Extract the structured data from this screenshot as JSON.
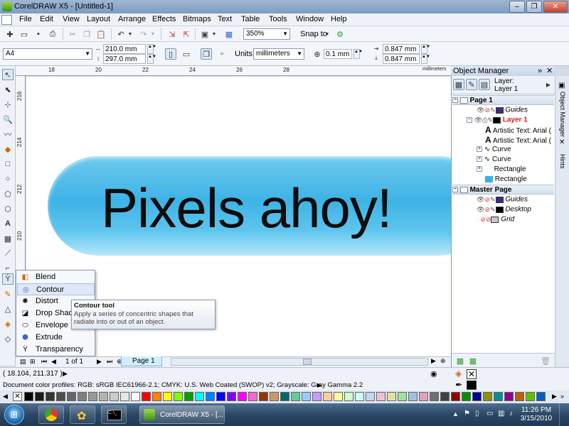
{
  "window": {
    "title": "CorelDRAW X5 - [Untitled-1]",
    "minimize": "–",
    "restore": "❐",
    "close": "✕"
  },
  "menu": [
    "File",
    "Edit",
    "View",
    "Layout",
    "Arrange",
    "Effects",
    "Bitmaps",
    "Text",
    "Table",
    "Tools",
    "Window",
    "Help"
  ],
  "std_toolbar": {
    "zoom": "350%",
    "snap_label": "Snap to"
  },
  "property_bar": {
    "paper": "A4",
    "width": "210.0 mm",
    "height": "297.0 mm",
    "units_label": "Units:",
    "units": "millimeters",
    "nudge": "0.1 mm",
    "dup_x": "0.847 mm",
    "dup_y": "0.847 mm"
  },
  "ruler_top": {
    "ticks": [
      "18",
      "20",
      "22",
      "24",
      "26",
      "28"
    ],
    "units": "millimeters"
  },
  "ruler_left": {
    "ticks": [
      "216",
      "214",
      "212",
      "210"
    ]
  },
  "canvas": {
    "artistic_text": "Pixels ahoy!"
  },
  "flyout": {
    "items": [
      {
        "label": "Blend",
        "icon": "blend-icon"
      },
      {
        "label": "Contour",
        "icon": "contour-icon"
      },
      {
        "label": "Distort",
        "icon": "distort-icon"
      },
      {
        "label": "Drop Shadow",
        "icon": "drop-shadow-icon"
      },
      {
        "label": "Envelope",
        "icon": "envelope-icon"
      },
      {
        "label": "Extrude",
        "icon": "extrude-icon"
      },
      {
        "label": "Transparency",
        "icon": "transparency-icon"
      }
    ],
    "selected": "Contour"
  },
  "tooltip": {
    "title": "Contour tool",
    "body": "Apply a series of concentric shapes that radiate into or out of an object."
  },
  "page_nav": {
    "counter": "1 of 1",
    "page_tab": "Page 1"
  },
  "object_manager": {
    "title": "Object Manager",
    "layer_label": "Layer:",
    "layer_name": "Layer 1",
    "tree": [
      {
        "label": "Page 1",
        "kind": "header"
      },
      {
        "label": "Guides",
        "kind": "layer",
        "color": "#3d2a8a"
      },
      {
        "label": "Layer 1",
        "kind": "layer-active",
        "color": "#000000"
      },
      {
        "label": "Artistic Text: Arial (",
        "kind": "object"
      },
      {
        "label": "Artistic Text: Arial (",
        "kind": "object"
      },
      {
        "label": "Curve",
        "kind": "object"
      },
      {
        "label": "Curve",
        "kind": "object"
      },
      {
        "label": "Rectangle",
        "kind": "object"
      },
      {
        "label": "Rectangle",
        "kind": "object",
        "color": "#3ab0e2"
      },
      {
        "label": "Master Page",
        "kind": "header"
      },
      {
        "label": "Guides",
        "kind": "layer",
        "color": "#3d2a8a"
      },
      {
        "label": "Desktop",
        "kind": "layer",
        "color": "#000000"
      },
      {
        "label": "Grid",
        "kind": "layer",
        "color": "#c8c8c8"
      }
    ],
    "side_tabs": [
      "Object Manager",
      "Hints"
    ]
  },
  "status": {
    "coords": "( 18.104, 211.317 )",
    "profiles": "Document color profiles: RGB: sRGB IEC61966-2.1; CMYK: U.S. Web Coated (SWOP) v2; Grayscale: Gray Gamma 2.2"
  },
  "palette": [
    "#000000",
    "#1a1a1a",
    "#333333",
    "#4d4d4d",
    "#666666",
    "#808080",
    "#999999",
    "#b3b3b3",
    "#cccccc",
    "#e6e6e6",
    "#ffffff",
    "#ff0000",
    "#ff8000",
    "#ffff00",
    "#80ff00",
    "#00a000",
    "#00ffff",
    "#0080ff",
    "#0000ff",
    "#8000ff",
    "#ff00ff",
    "#ff66cc",
    "#993300",
    "#cc9966",
    "#006666",
    "#66cc99",
    "#99ccff",
    "#cc99ff",
    "#ffcc99",
    "#ffff99",
    "#ccffcc",
    "#ccffff",
    "#c0d8f0",
    "#f0c0d8",
    "#e0e0a0",
    "#a0e0a0",
    "#a0c0e0",
    "#e0a0c0",
    "#707070",
    "#404040",
    "#900000",
    "#009000",
    "#000090",
    "#909000",
    "#009090",
    "#900090",
    "#c06000",
    "#60c000",
    "#0060c0"
  ],
  "taskbar": {
    "active_app": "CorelDRAW X5 - [...",
    "time": "11:26 PM",
    "date": "3/15/2010"
  }
}
